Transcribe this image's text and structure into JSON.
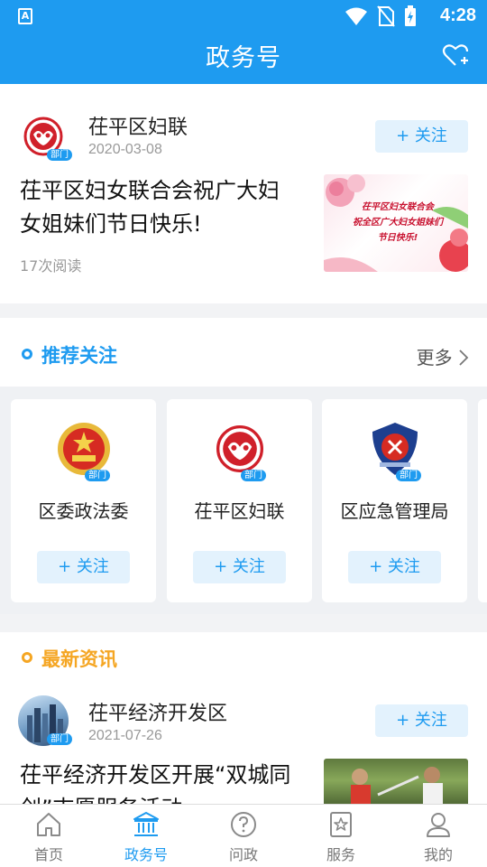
{
  "status_bar": {
    "time": "4:28",
    "app_badge": "A"
  },
  "header": {
    "title": "政务号",
    "action_icon": "heart-plus-icon"
  },
  "featured": {
    "account_name": "茌平区妇联",
    "date": "2020-03-08",
    "badge": "部门",
    "follow_label": "+ 关注",
    "article_title_line1": "茌平区妇女联合会祝广大妇",
    "article_title_line2": "女姐妹们节日快乐!",
    "reads": "17次阅读",
    "thumb_text": [
      "茌平区妇女联合会",
      "祝全区广大妇女姐妹们",
      "节日快乐!"
    ]
  },
  "recommend": {
    "title": "推荐关注",
    "more_label": "更多",
    "items": [
      {
        "name": "区委政法委",
        "badge": "部门",
        "follow_label": "+ 关注",
        "icon": "court-emblem-icon"
      },
      {
        "name": "茌平区妇联",
        "badge": "部门",
        "follow_label": "+ 关注",
        "icon": "womens-federation-icon"
      },
      {
        "name": "区应急管理局",
        "badge": "部门",
        "follow_label": "+ 关注",
        "icon": "emergency-mgmt-icon"
      }
    ]
  },
  "latest": {
    "title": "最新资讯",
    "account_name": "茌平经济开发区",
    "date": "2021-07-26",
    "badge": "部门",
    "follow_label": "+ 关注",
    "article_title_line1": "茌平经济开发区开展“双城同",
    "article_title_line2": "创”志愿服务活动"
  },
  "tabbar": {
    "items": [
      {
        "label": "首页",
        "icon": "home-icon",
        "active": false
      },
      {
        "label": "政务号",
        "icon": "government-building-icon",
        "active": true
      },
      {
        "label": "问政",
        "icon": "question-icon",
        "active": false
      },
      {
        "label": "服务",
        "icon": "star-bookmark-icon",
        "active": false
      },
      {
        "label": "我的",
        "icon": "user-icon",
        "active": false
      }
    ]
  },
  "colors": {
    "primary": "#1e9bf0",
    "accent_yellow": "#f5a623",
    "follow_bg": "#e3f2fd"
  }
}
